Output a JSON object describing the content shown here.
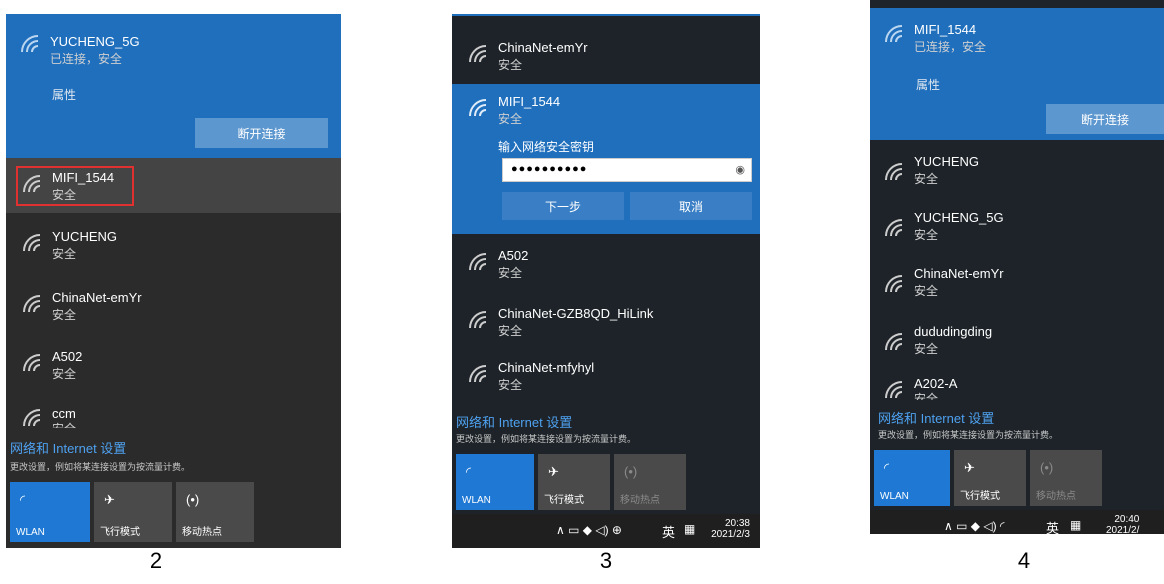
{
  "panel2": {
    "connected": {
      "ssid": "YUCHENG_5G",
      "status": "已连接，安全",
      "props": "属性",
      "disconnect": "断开连接"
    },
    "networks": [
      {
        "ssid": "MIFI_1544",
        "sub": "安全"
      },
      {
        "ssid": "YUCHENG",
        "sub": "安全"
      },
      {
        "ssid": "ChinaNet-emYr",
        "sub": "安全"
      },
      {
        "ssid": "A502",
        "sub": "安全"
      },
      {
        "ssid": "ccm",
        "sub": "安全"
      }
    ],
    "settings_link": "网络和 Internet 设置",
    "settings_hint": "更改设置，例如将某连接设置为按流量计费。",
    "tiles": {
      "wlan": "WLAN",
      "airplane": "飞行模式",
      "hotspot": "移动热点"
    }
  },
  "panel3": {
    "networks_top": [
      {
        "ssid": "ChinaNet-emYr",
        "sub": "安全"
      }
    ],
    "selected": {
      "ssid": "MIFI_1544",
      "sub": "安全",
      "key_label": "输入网络安全密钥",
      "key_value": "●●●●●●●●●●",
      "next": "下一步",
      "cancel": "取消"
    },
    "networks": [
      {
        "ssid": "A502",
        "sub": "安全"
      },
      {
        "ssid": "ChinaNet-GZB8QD_HiLink",
        "sub": "安全"
      },
      {
        "ssid": "ChinaNet-mfyhyl",
        "sub": "安全"
      }
    ],
    "settings_link": "网络和 Internet 设置",
    "settings_hint": "更改设置，例如将某连接设置为按流量计费。",
    "tiles": {
      "wlan": "WLAN",
      "airplane": "飞行模式",
      "hotspot": "移动热点"
    },
    "taskbar": {
      "ime": "英",
      "time": "20:38",
      "date": "2021/2/3"
    }
  },
  "panel4": {
    "connected": {
      "ssid": "MIFI_1544",
      "status": "已连接，安全",
      "props": "属性",
      "disconnect": "断开连接"
    },
    "networks": [
      {
        "ssid": "YUCHENG",
        "sub": "安全"
      },
      {
        "ssid": "YUCHENG_5G",
        "sub": "安全"
      },
      {
        "ssid": "ChinaNet-emYr",
        "sub": "安全"
      },
      {
        "ssid": "dududingding",
        "sub": "安全"
      },
      {
        "ssid": "A202-A",
        "sub": "安全"
      }
    ],
    "settings_link": "网络和 Internet 设置",
    "settings_hint": "更改设置，例如将某连接设置为按流量计费。",
    "tiles": {
      "wlan": "WLAN",
      "airplane": "飞行模式",
      "hotspot": "移动热点"
    },
    "taskbar": {
      "ime": "英",
      "time": "20:40",
      "date": "2021/2/"
    }
  },
  "captions": [
    "2",
    "3",
    "4"
  ],
  "colors": {
    "accent": "#1f6fbd",
    "link": "#4ea1f0",
    "highlight_box": "#e03030"
  }
}
